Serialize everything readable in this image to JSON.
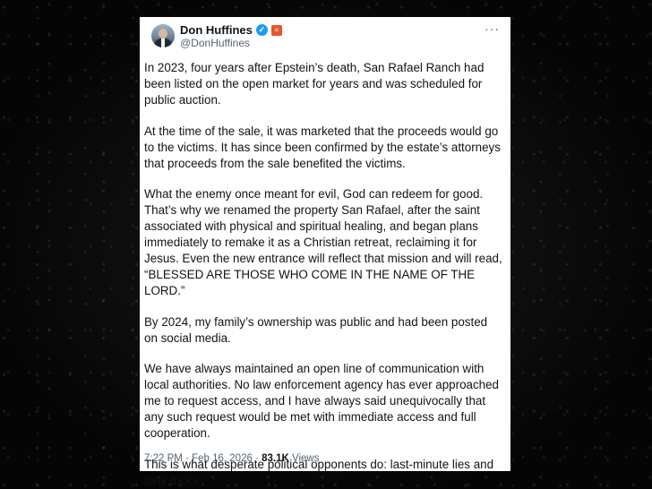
{
  "tweet": {
    "author_name": "Don Huffines",
    "handle": "@DonHuffines",
    "paragraphs": [
      "In 2023, four years after Epstein’s death, San Rafael Ranch had been listed on the open market for years and was scheduled for public auction.",
      "At the time of the sale, it was marketed that the proceeds would go to the victims. It has since been confirmed by the estate’s attorneys that proceeds from the sale benefited the victims.",
      "What the enemy once meant for evil, God can redeem for good. That’s why we renamed the property San Rafael, after the saint associated with physical and spiritual healing, and began plans immediately to remake it as a Christian retreat, reclaiming it for Jesus. Even the new entrance will reflect that mission and will read, “BLESSED ARE THOSE WHO COME IN THE NAME OF THE LORD.”",
      "By 2024, my family’s ownership was public and had been posted on social media.",
      "We have always maintained an open line of communication with local authorities. No law enforcement agency has ever approached me to request access, and I have always said unequivocally that any such request would be met with immediate access and full cooperation.",
      "This is what desperate political opponents do: last-minute lies and dirty tricks."
    ],
    "time": "7:22 PM",
    "separator": "·",
    "date": "Feb 16, 2026",
    "views_count": "83.1K",
    "views_label": "Views"
  },
  "icons": {
    "verified": "verified-badge-icon",
    "affiliation": "affiliation-badge-icon",
    "more": "more-options-icon"
  },
  "colors": {
    "verified_blue": "#1d9bf0",
    "affiliation_orange": "#e8552a",
    "text_primary": "#0f1419",
    "text_secondary": "#536471"
  }
}
